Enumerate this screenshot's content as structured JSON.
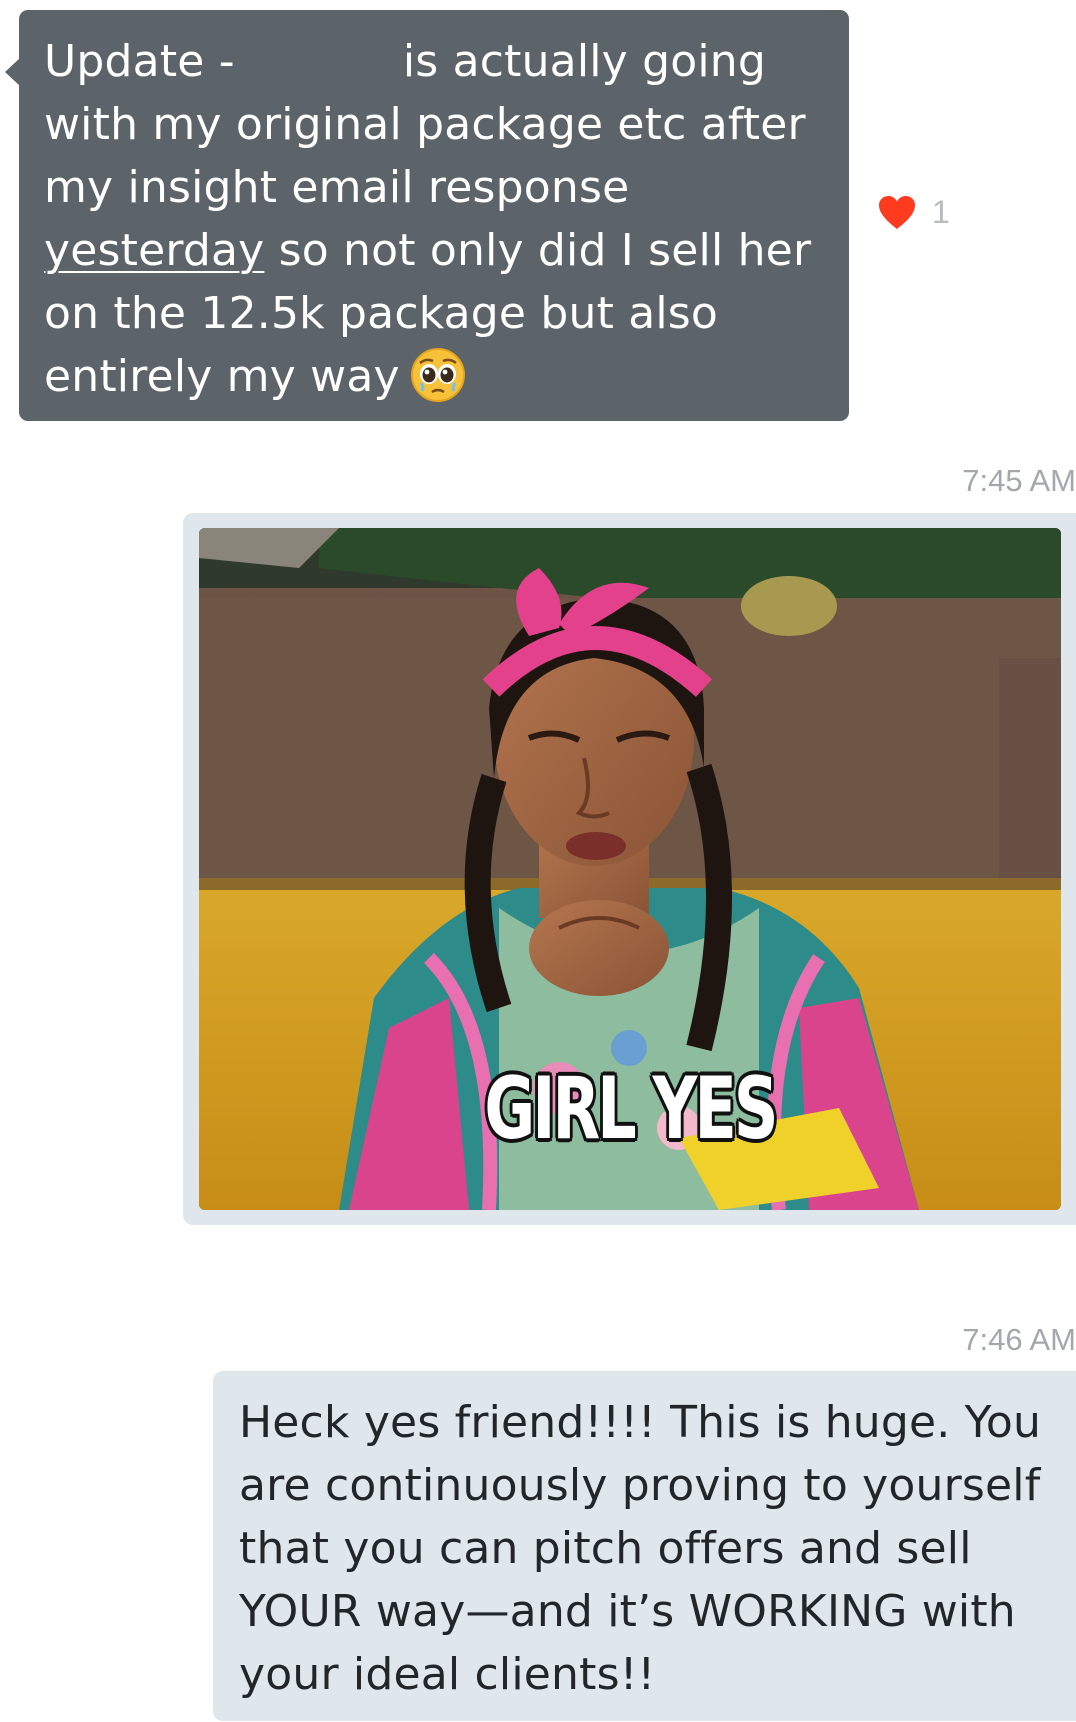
{
  "incoming_message": {
    "lines": [
      {
        "before_redaction": "Update -",
        "after_redaction": "is actually going"
      },
      "with my original package etc after",
      "my insight email response",
      {
        "link_text": "yesterday",
        "rest": " so not only did I sell her"
      },
      "on the 12.5k package but also",
      "entirely my way"
    ],
    "emoji": "pleading-face"
  },
  "reaction": {
    "icon": "heart-icon",
    "count": "1",
    "color": "#ff3b1f"
  },
  "timestamps": [
    "7:45 AM",
    "7:46 AM"
  ],
  "gif": {
    "caption": "GIRL YES"
  },
  "outgoing_message": {
    "lines": [
      "Heck yes friend!!!! This is huge. You",
      "are continuously proving to yourself",
      "that you can pitch offers and sell",
      "YOUR way—and it’s WORKING with",
      "your ideal clients!!"
    ]
  },
  "colors": {
    "incoming_bubble": "#5c6369",
    "outgoing_bubble": "#dfe6ec",
    "timestamp": "#a4a8ad"
  }
}
